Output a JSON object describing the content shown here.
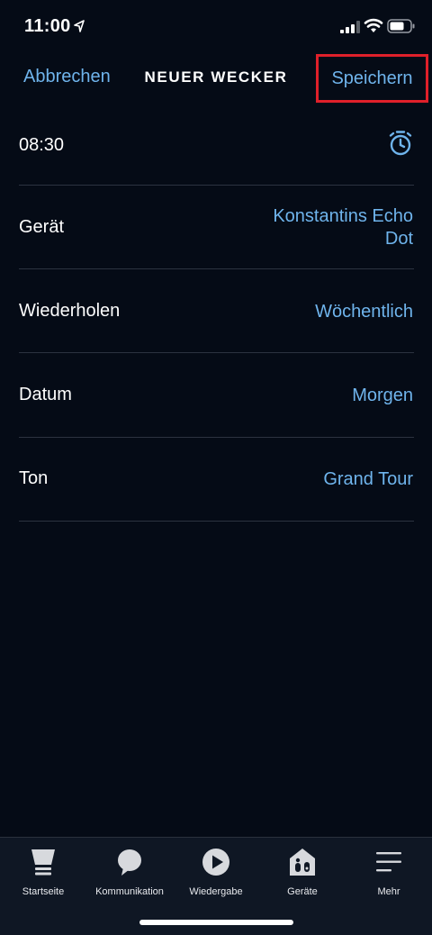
{
  "status_bar": {
    "time": "11:00",
    "icons": [
      "location-arrow-icon",
      "signal-icon",
      "wifi-icon",
      "battery-icon"
    ]
  },
  "nav": {
    "cancel_label": "Abbrechen",
    "title": "NEUER WECKER",
    "save_label": "Speichern",
    "highlight_color": "#e0202a"
  },
  "rows": {
    "time": {
      "value": "08:30",
      "icon": "alarm-clock-icon"
    },
    "device": {
      "label": "Gerät",
      "value_line1": "Konstantins Echo",
      "value_line2": "Dot"
    },
    "repeat": {
      "label": "Wiederholen",
      "value": "Wöchentlich"
    },
    "date": {
      "label": "Datum",
      "value": "Morgen"
    },
    "tone": {
      "label": "Ton",
      "value": "Grand Tour"
    }
  },
  "tabbar": {
    "items": [
      {
        "label": "Startseite",
        "icon": "home-icon"
      },
      {
        "label": "Kommunikation",
        "icon": "chat-bubble-icon"
      },
      {
        "label": "Wiedergabe",
        "icon": "play-icon"
      },
      {
        "label": "Geräte",
        "icon": "devices-house-icon"
      },
      {
        "label": "Mehr",
        "icon": "menu-icon"
      }
    ]
  },
  "colors": {
    "background": "#050b16",
    "accent": "#6fb4ec",
    "text": "#ffffff"
  }
}
